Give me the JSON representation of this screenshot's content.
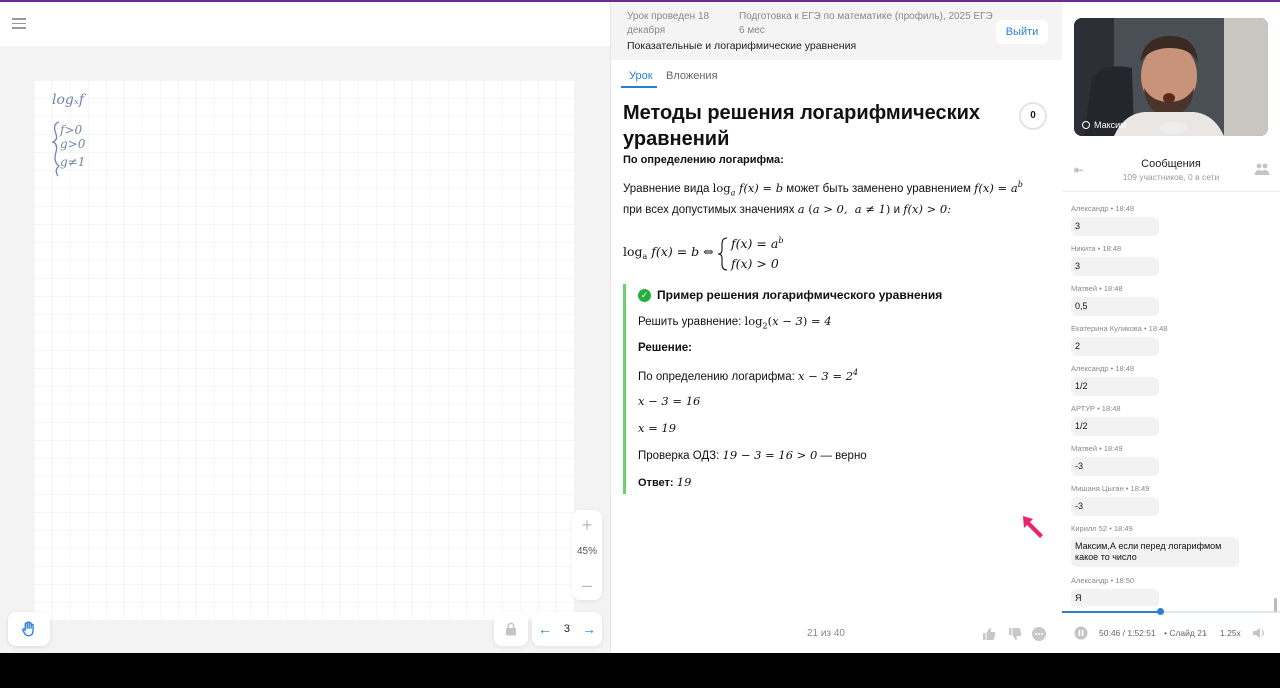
{
  "board": {
    "zoom": "45%",
    "page": "3",
    "handwriting_lines": [
      "logₓf",
      "f>0",
      "g>0",
      "g≠1"
    ]
  },
  "lesson": {
    "date": "Урок проведен 18 декабря",
    "course": "Подготовка к ЕГЭ по математике (профиль), 2025 ЕГЭ 6 мес",
    "topic": "Показательные и логарифмические уравнения",
    "exit_label": "Выйти",
    "tabs": [
      {
        "label": "Урок"
      },
      {
        "label": "Вложения"
      }
    ],
    "title": "Методы решения логарифмических уравнений",
    "counter": "0",
    "section_heading": "По определению логарифма:",
    "p1_start": "Уравнение вида",
    "p1_mid": "может быть заменено уравнением",
    "p2_start": "при всех допустимых значениях",
    "p2_and": "и",
    "example": {
      "title": "Пример решения логарифмического уравнения",
      "solve_label": "Решить уравнение:",
      "solution_label": "Решение:",
      "by_def_label": "По определению логарифма:",
      "check_label": "Проверка ОДЗ:",
      "check_suffix": "— верно",
      "answer_label": "Ответ:"
    },
    "slide_counter": "21 из 40"
  },
  "chat": {
    "presenter_name": "Максим",
    "title": "Сообщения",
    "subtitle": "109 участников, 0 в сети",
    "messages": [
      {
        "meta": "Александр • 18:48",
        "text": "3"
      },
      {
        "meta": "Никита • 18:48",
        "text": "3"
      },
      {
        "meta": "Матвей • 18:48",
        "text": "0,5"
      },
      {
        "meta": "Екатерина Куликова • 18:48",
        "text": "2"
      },
      {
        "meta": "Александр • 18:48",
        "text": "1/2"
      },
      {
        "meta": "АРТУР • 18:48",
        "text": "1/2"
      },
      {
        "meta": "Матвей • 18:49",
        "text": "-3"
      },
      {
        "meta": "Мишаня Цыган • 18:49",
        "text": "-3"
      },
      {
        "meta": "Кирилл 52 • 18:49",
        "text": "Максим,А если перед логарифмом какое то число"
      },
      {
        "meta": "Александр • 18:50",
        "text": "Я"
      }
    ],
    "player": {
      "time": "50:46 / 1:52:51",
      "slide": "• Слайд 21",
      "speed": "1.25x",
      "progress": 0.45
    }
  },
  "colors": {
    "accent": "#2a7fd4",
    "example_border": "#6ad26a",
    "cursor": "#e8246e",
    "top_strip": "#6b2a8e"
  }
}
